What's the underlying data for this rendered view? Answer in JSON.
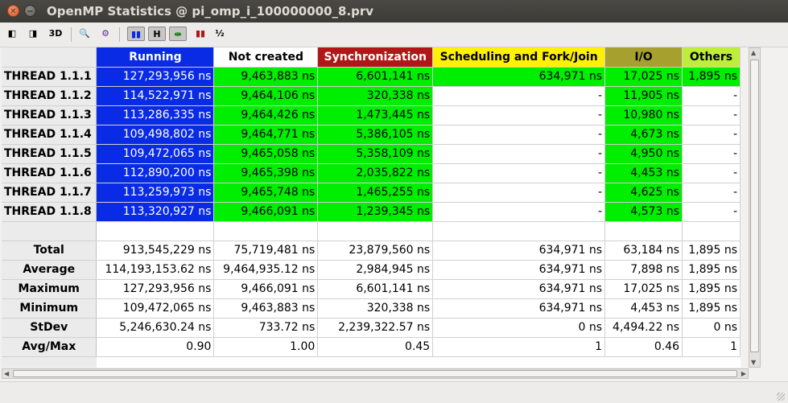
{
  "window": {
    "title": "OpenMP Statistics @ pi_omp_i_100000000_8.prv"
  },
  "toolbar": {
    "items": [
      {
        "name": "open-control-icon",
        "glyph": "◧"
      },
      {
        "name": "open-data-icon",
        "glyph": "◨"
      },
      {
        "name": "3d-icon",
        "glyph": "3D"
      },
      {
        "name": "zoom-icon",
        "glyph": "🔍"
      },
      {
        "name": "settings-icon",
        "glyph": "⚙"
      },
      {
        "name": "color-mode-icon",
        "glyph": "▮▮"
      },
      {
        "name": "hide-columns-icon",
        "glyph": "H"
      },
      {
        "name": "horizontal-icon",
        "glyph": "⇹"
      },
      {
        "name": "semantic-color-icon",
        "glyph": "▮▮"
      },
      {
        "name": "label-icon",
        "glyph": "½"
      }
    ]
  },
  "table": {
    "columns": [
      {
        "label": "Running",
        "bg": "#0a2be6",
        "fg": "#ffffff"
      },
      {
        "label": "Not created",
        "bg": "#ffffff",
        "fg": "#000000"
      },
      {
        "label": "Synchronization",
        "bg": "#b01818",
        "fg": "#ffffff"
      },
      {
        "label": "Scheduling and Fork/Join",
        "bg": "#fff200",
        "fg": "#000000"
      },
      {
        "label": "I/O",
        "bg": "#a6a12e",
        "fg": "#000000"
      },
      {
        "label": "Others",
        "bg": "#bfee3a",
        "fg": "#000000"
      }
    ],
    "threads": [
      {
        "label": "THREAD 1.1.1",
        "values": [
          "127,293,956 ns",
          "9,463,883 ns",
          "6,601,141 ns",
          "634,971 ns",
          "17,025 ns",
          "1,895 ns"
        ]
      },
      {
        "label": "THREAD 1.1.2",
        "values": [
          "114,522,971 ns",
          "9,464,106 ns",
          "320,338 ns",
          "-",
          "11,905 ns",
          "-"
        ]
      },
      {
        "label": "THREAD 1.1.3",
        "values": [
          "113,286,335 ns",
          "9,464,426 ns",
          "1,473,445 ns",
          "-",
          "10,980 ns",
          "-"
        ]
      },
      {
        "label": "THREAD 1.1.4",
        "values": [
          "109,498,802 ns",
          "9,464,771 ns",
          "5,386,105 ns",
          "-",
          "4,673 ns",
          "-"
        ]
      },
      {
        "label": "THREAD 1.1.5",
        "values": [
          "109,472,065 ns",
          "9,465,058 ns",
          "5,358,109 ns",
          "-",
          "4,950 ns",
          "-"
        ]
      },
      {
        "label": "THREAD 1.1.6",
        "values": [
          "112,890,200 ns",
          "9,465,398 ns",
          "2,035,822 ns",
          "-",
          "4,453 ns",
          "-"
        ]
      },
      {
        "label": "THREAD 1.1.7",
        "values": [
          "113,259,973 ns",
          "9,465,748 ns",
          "1,465,255 ns",
          "-",
          "4,625 ns",
          "-"
        ]
      },
      {
        "label": "THREAD 1.1.8",
        "values": [
          "113,320,927 ns",
          "9,466,091 ns",
          "1,239,345 ns",
          "-",
          "4,573 ns",
          "-"
        ]
      }
    ],
    "stats": [
      {
        "label": "Total",
        "values": [
          "913,545,229 ns",
          "75,719,481 ns",
          "23,879,560 ns",
          "634,971 ns",
          "63,184 ns",
          "1,895 ns"
        ]
      },
      {
        "label": "Average",
        "values": [
          "114,193,153.62 ns",
          "9,464,935.12 ns",
          "2,984,945 ns",
          "634,971 ns",
          "7,898 ns",
          "1,895 ns"
        ]
      },
      {
        "label": "Maximum",
        "values": [
          "127,293,956 ns",
          "9,466,091 ns",
          "6,601,141 ns",
          "634,971 ns",
          "17,025 ns",
          "1,895 ns"
        ]
      },
      {
        "label": "Minimum",
        "values": [
          "109,472,065 ns",
          "9,463,883 ns",
          "320,338 ns",
          "634,971 ns",
          "4,453 ns",
          "1,895 ns"
        ]
      },
      {
        "label": "StDev",
        "values": [
          "5,246,630.24 ns",
          "733.72 ns",
          "2,239,322.57 ns",
          "0 ns",
          "4,494.22 ns",
          "0 ns"
        ]
      },
      {
        "label": "Avg/Max",
        "values": [
          "0.90",
          "1.00",
          "0.45",
          "1",
          "0.46",
          "1"
        ]
      }
    ],
    "cell_colors": {
      "running": "#0a2be6",
      "active": "#00ee00",
      "empty": "#ffffff"
    }
  }
}
